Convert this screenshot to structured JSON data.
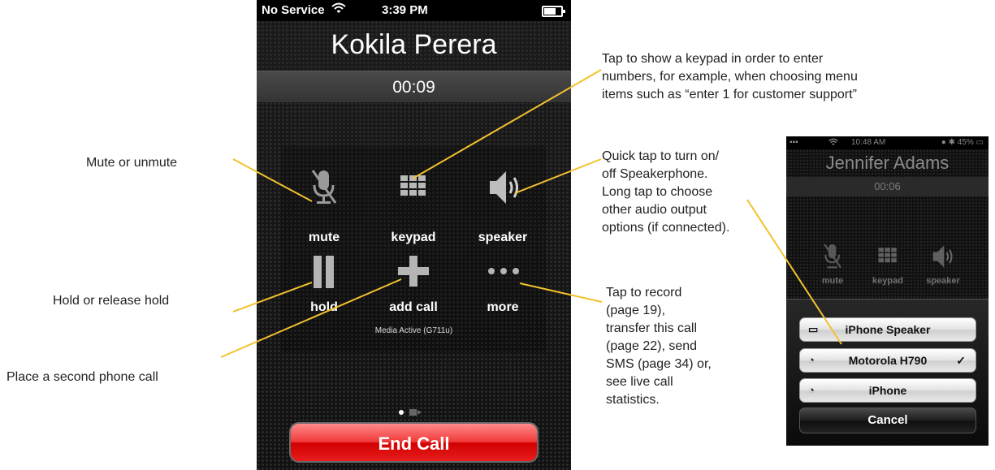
{
  "phone": {
    "status": {
      "carrier": "No Service",
      "time": "3:39 PM"
    },
    "caller_name": "Kokila Perera",
    "call_timer": "00:09",
    "controls": [
      {
        "label": "mute",
        "icon": "mic-muted-icon"
      },
      {
        "label": "keypad",
        "icon": "keypad-icon"
      },
      {
        "label": "speaker",
        "icon": "speaker-icon"
      },
      {
        "label": "hold",
        "icon": "pause-icon"
      },
      {
        "label": "add call",
        "icon": "plus-icon"
      },
      {
        "label": "more",
        "icon": "ellipsis-icon"
      }
    ],
    "media_status": "Media Active (G711u)",
    "end_call": "End Call",
    "end_call_color": "#e81d1d"
  },
  "annotations": {
    "mute": "Mute or unmute",
    "hold": "Hold or release hold",
    "add_call": "Place a second phone call",
    "keypad": [
      "Tap to show a keypad in order to enter",
      "numbers, for example, when choosing menu",
      "items such as “enter 1 for customer support”"
    ],
    "speaker": [
      "Quick tap to turn on/",
      "off Speakerphone.",
      "Long tap to choose",
      "other audio output",
      "options (if connected)."
    ],
    "more": [
      "Tap to record",
      "(page 19),",
      "transfer this call",
      "(page 22), send",
      "SMS (page 34) or,",
      "see live call",
      "statistics."
    ]
  },
  "phone2": {
    "status": {
      "time": "10:48 AM",
      "battery": "45%"
    },
    "caller_name": "Jennifer Adams",
    "call_timer": "00:06",
    "controls": [
      {
        "label": "mute",
        "icon": "mic-muted-icon"
      },
      {
        "label": "keypad",
        "icon": "keypad-icon"
      },
      {
        "label": "speaker",
        "icon": "speaker-icon"
      }
    ],
    "audio_options": [
      {
        "label": "iPhone Speaker",
        "icon": "monitor-icon",
        "selected": false
      },
      {
        "label": "Motorola H790",
        "icon": "bluetooth-headset-icon",
        "selected": true
      },
      {
        "label": "iPhone",
        "icon": "handset-icon",
        "selected": false
      }
    ],
    "cancel": "Cancel"
  },
  "colors": {
    "callout_line": "#f2c12e",
    "end_call_red": "#e81d1d"
  }
}
